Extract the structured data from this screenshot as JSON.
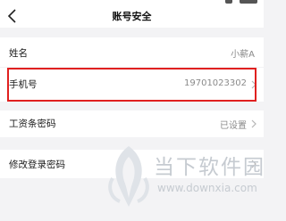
{
  "header": {
    "title": "账号安全",
    "back_icon": "chevron-left-icon"
  },
  "rows": [
    {
      "label": "姓名",
      "value": "小薪A"
    },
    {
      "label": "手机号",
      "value": "19701023302"
    },
    {
      "label": "工资条密码",
      "value": "已设置"
    },
    {
      "label": "修改登录密码",
      "value": ""
    }
  ],
  "highlight_color": "#e0201f",
  "watermark": {
    "title": "当下软件园",
    "url": "www.downxia.com"
  }
}
